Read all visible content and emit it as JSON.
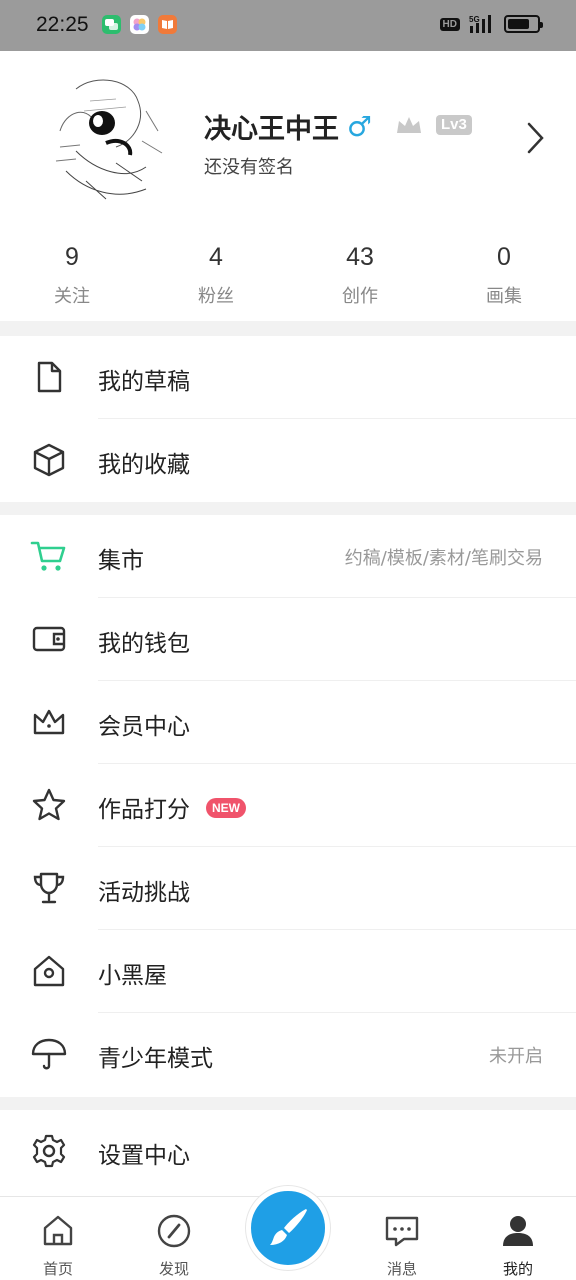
{
  "status_bar": {
    "time": "22:25",
    "hd_label": "HD",
    "network_label": "5G",
    "battery_level": 0.75
  },
  "profile": {
    "username": "决心王中王",
    "gender_symbol": "♂",
    "level_badge": "Lv3",
    "signature": "还没有签名",
    "stats": [
      {
        "value": "9",
        "label": "关注"
      },
      {
        "value": "4",
        "label": "粉丝"
      },
      {
        "value": "43",
        "label": "创作"
      },
      {
        "value": "0",
        "label": "画集"
      }
    ]
  },
  "menu_group_1": [
    {
      "label": "我的草稿",
      "icon": "file-icon"
    },
    {
      "label": "我的收藏",
      "icon": "box-icon"
    }
  ],
  "menu_group_2": [
    {
      "label": "集市",
      "icon": "cart-icon",
      "hint": "约稿/模板/素材/笔刷交易"
    },
    {
      "label": "我的钱包",
      "icon": "wallet-icon"
    },
    {
      "label": "会员中心",
      "icon": "crown-icon"
    },
    {
      "label": "作品打分",
      "icon": "star-icon",
      "badge": "NEW"
    },
    {
      "label": "活动挑战",
      "icon": "trophy-icon"
    },
    {
      "label": "小黑屋",
      "icon": "house-icon"
    },
    {
      "label": "青少年模式",
      "icon": "umbrella-icon",
      "hint": "未开启"
    }
  ],
  "menu_group_3": [
    {
      "label": "设置中心",
      "icon": "gear-icon"
    }
  ],
  "tabbar": {
    "tabs": [
      {
        "label": "首页",
        "icon": "home-icon"
      },
      {
        "label": "发现",
        "icon": "compass-icon"
      },
      {
        "label": "消息",
        "icon": "message-icon"
      },
      {
        "label": "我的",
        "icon": "user-icon"
      }
    ],
    "fab_icon": "brush-icon"
  },
  "colors": {
    "accent_blue": "#1f9fe6",
    "accent_green": "#2fcf8f",
    "new_badge": "#f0536b"
  }
}
